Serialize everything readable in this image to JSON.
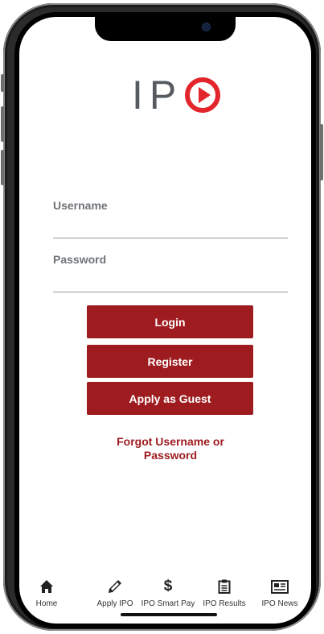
{
  "app": {
    "logo_text": "IP",
    "logo_play_color": "#e2262c",
    "accent": "#9e1c20"
  },
  "form": {
    "username_label": "Username",
    "password_label": "Password",
    "username_value": "",
    "password_value": ""
  },
  "buttons": {
    "login": "Login",
    "register": "Register",
    "guest": "Apply as Guest"
  },
  "forgot_link": "Forgot Username or Password",
  "tabbar": [
    {
      "label": "Home",
      "icon": "home-icon"
    },
    {
      "label": "Apply IPO",
      "icon": "pencil-icon"
    },
    {
      "label": "IPO Smart Pay",
      "icon": "dollar-icon"
    },
    {
      "label": "IPO Results",
      "icon": "clipboard-icon"
    },
    {
      "label": "IPO News",
      "icon": "newspaper-icon"
    }
  ]
}
